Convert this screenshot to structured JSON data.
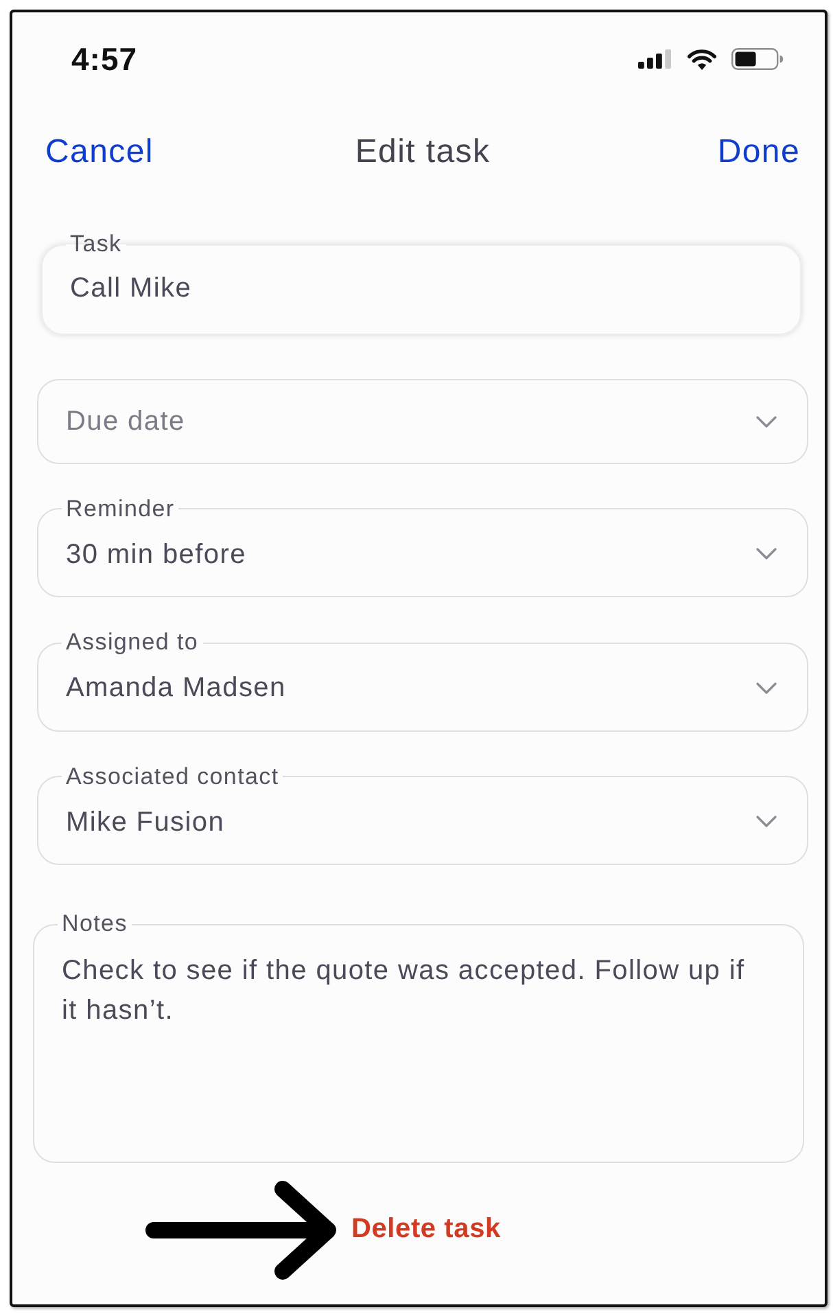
{
  "status_bar": {
    "time": "4:57"
  },
  "nav": {
    "cancel": "Cancel",
    "title": "Edit task",
    "done": "Done"
  },
  "fields": [
    {
      "kind": "text",
      "label": "Task",
      "value": "Call Mike",
      "focused": true
    },
    {
      "kind": "select",
      "placeholder": "Due date",
      "focused": false
    },
    {
      "kind": "select",
      "label": "Reminder",
      "value": "30 min before",
      "focused": false
    },
    {
      "kind": "select",
      "label": "Assigned to",
      "value": "Amanda Madsen",
      "focused": false
    },
    {
      "kind": "select",
      "label": "Associated contact",
      "value": "Mike Fusion",
      "focused": false
    },
    {
      "kind": "textarea",
      "label": "Notes",
      "value": "Check to see if the quote was accepted. Follow up if it hasn’t.",
      "focused": false
    }
  ],
  "delete_button": "Delete task"
}
